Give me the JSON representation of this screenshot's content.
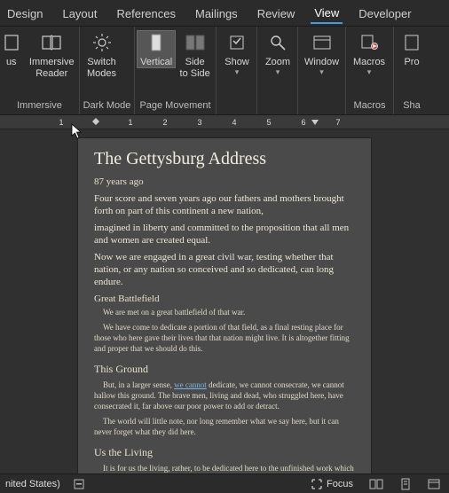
{
  "tabs": {
    "design": "Design",
    "layout": "Layout",
    "references": "References",
    "mailings": "Mailings",
    "review": "Review",
    "view": "View",
    "developer": "Developer"
  },
  "ribbon": {
    "focus_partial": "us",
    "immersive_reader": "Immersive\nReader",
    "switch_modes": "Switch\nModes",
    "vertical": "Vertical",
    "side_to_side": "Side\nto Side",
    "show": "Show",
    "zoom": "Zoom",
    "window": "Window",
    "macros": "Macros",
    "prop_partial": "Pro",
    "group_immersive": "Immersive",
    "group_darkmode": "Dark Mode",
    "group_pagemovement": "Page Movement",
    "group_macros": "Macros",
    "group_sha_partial": "Sha"
  },
  "ruler": {
    "n1a": "1",
    "n1b": "1",
    "n2": "2",
    "n3": "3",
    "n4": "4",
    "n5": "5",
    "n6": "6",
    "n7": "7"
  },
  "doc": {
    "title": "The Gettysburg Address",
    "ago": "87 years ago",
    "p1": "Four score and seven years ago our fathers and mothers brought forth on part of this continent a new nation,",
    "p2": "imagined in liberty and committed to the proposition that all men and women are created equal.",
    "p3": "Now we are engaged in a great civil war, testing whether that nation, or any nation so conceived and so dedicated, can long endure.",
    "sub1": "Great Battlefield",
    "s1": "We are met on a great battlefield of that war.",
    "s2": "We have come to dedicate a portion of that field, as a final resting place for those who here gave their lives that that nation might live. It is altogether fitting and proper that we should do this.",
    "ground": "This Ground",
    "s3a": "But, in a larger sense, ",
    "s3link": "we cannot",
    "s3b": " dedicate, we cannot consecrate, we cannot hallow this ground. The brave men, living and dead, who struggled here, have consecrated it, far above our poor power to add or detract.",
    "s4": "The world will little note, nor long remember what we say here, but it can never forget what they did here.",
    "living": "Us the Living",
    "s5": "It is for us the living, rather, to be dedicated here to the unfinished work which"
  },
  "status": {
    "lang": "nited States)",
    "focus": "Focus"
  }
}
